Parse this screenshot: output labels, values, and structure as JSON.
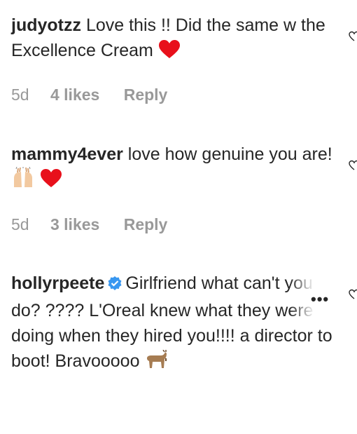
{
  "comments": [
    {
      "username": "judyotzz",
      "text": "Love this !! Did the same w the Excellence Cream",
      "time": "5d",
      "likes": "4 likes",
      "reply": "Reply"
    },
    {
      "username": "mammy4ever",
      "text": "love how genuine you are!",
      "time": "5d",
      "likes": "3 likes",
      "reply": "Reply"
    },
    {
      "username": "hollyrpeete",
      "text": "Girlfriend what can't you do? ???? L'Oreal knew what they were doing when they hired you!!!! a director to boot! Bravooooo",
      "time": "",
      "likes": "",
      "reply": ""
    }
  ],
  "icons": {
    "like": "heart-outline-icon",
    "more": "more-options-icon",
    "verified": "verified-badge-icon"
  }
}
